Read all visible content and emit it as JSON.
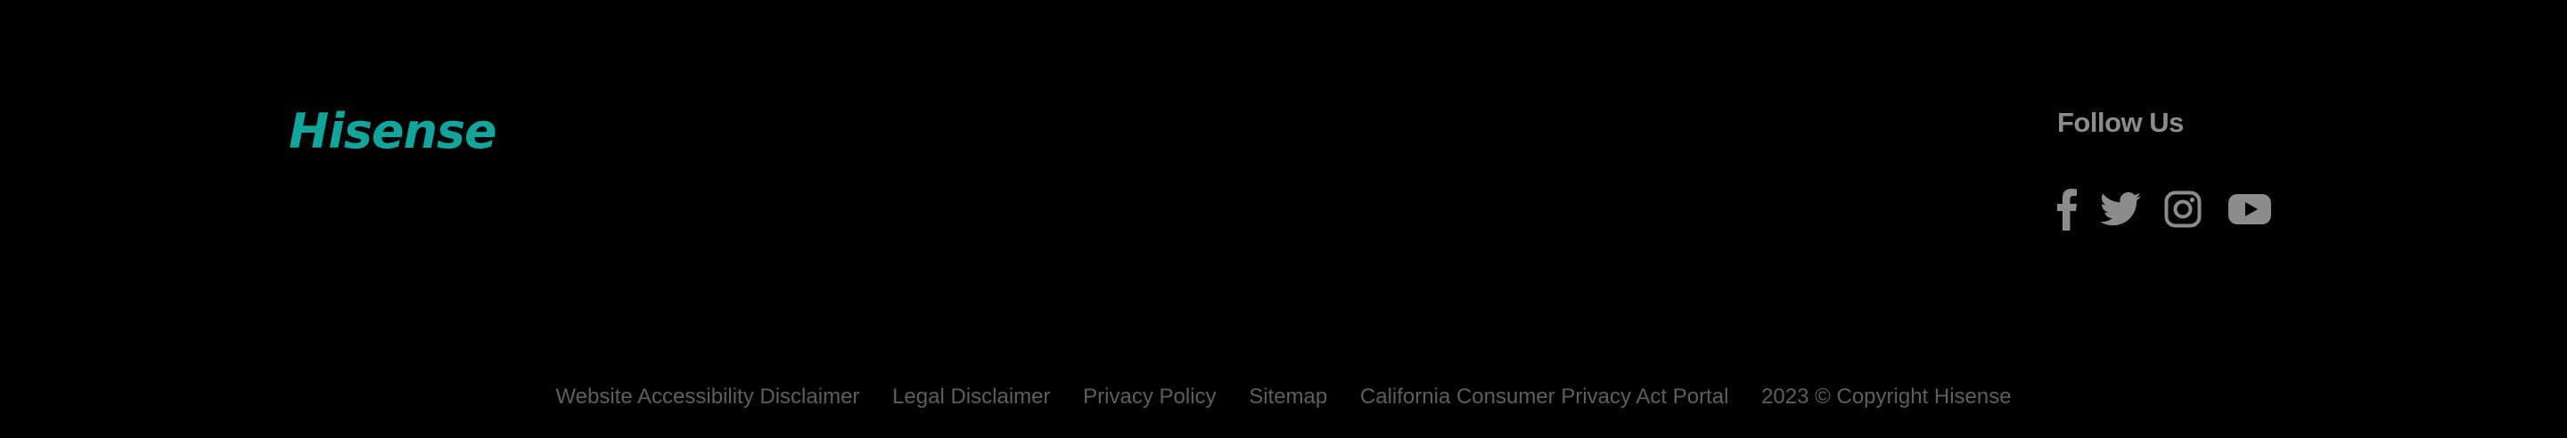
{
  "brand": {
    "logo_text": "Hisense",
    "logo_color": "#13a59d"
  },
  "follow": {
    "title": "Follow Us",
    "icons": [
      "facebook-icon",
      "twitter-icon",
      "instagram-icon",
      "youtube-icon"
    ],
    "icon_color": "#8c8c8c"
  },
  "bottom": {
    "links": [
      "Website Accessibility Disclaimer",
      "Legal Disclaimer",
      "Privacy Policy",
      "Sitemap",
      "California Consumer Privacy Act Portal"
    ],
    "copyright": "2023 © Copyright Hisense",
    "text_color": "#5e5e5e"
  },
  "colors": {
    "background": "#000000"
  }
}
